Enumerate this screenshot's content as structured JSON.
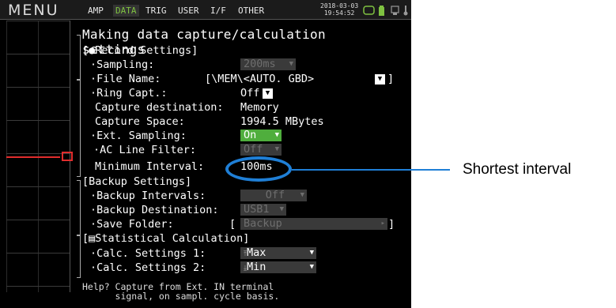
{
  "topbar": {
    "menu": "MENU",
    "tabs": [
      "AMP",
      "DATA",
      "TRIG",
      "USER",
      "I/F",
      "OTHER"
    ],
    "active_tab": "DATA",
    "date": "2018-03-03",
    "time": "19:54:52"
  },
  "panel": {
    "title": "Making data capture/calculation settings",
    "record": {
      "header": "[●Record Settings]",
      "sampling_label": "·Sampling:",
      "sampling_value": "200ms",
      "file_name_label": "·File Name:",
      "file_name_value": "[\\MEM\\<AUTO. GBD>",
      "file_name_close": "]",
      "ring_capt_label": "·Ring Capt.:",
      "ring_capt_value": "Off",
      "capture_dest_label": "Capture destination:",
      "capture_dest_value": "Memory",
      "capture_space_label": "Capture Space:",
      "capture_space_value": "1994.5 MBytes",
      "ext_sampling_label": "·Ext. Sampling:",
      "ext_sampling_value": "On",
      "ac_filter_label": "·AC Line Filter:",
      "ac_filter_value": "Off",
      "min_interval_label": "Minimum Interval:",
      "min_interval_value": "100ms"
    },
    "backup": {
      "header": "[Backup Settings]",
      "intervals_label": "·Backup Intervals:",
      "intervals_value": "Off",
      "destination_label": "·Backup Destination:",
      "destination_value": "USB1",
      "folder_label": "·Save Folder:",
      "folder_open": "[",
      "folder_value": "Backup",
      "folder_close": "]"
    },
    "stats": {
      "header": "[▤Statistical Calculation]",
      "calc1_label": "·Calc. Settings 1:",
      "calc1_value": "Max",
      "calc2_label": "·Calc. Settings 2:",
      "calc2_value": "Min"
    }
  },
  "help": {
    "line1": "Help? Capture from Ext. IN terminal",
    "line2": "      signal, on sampl. cycle basis."
  },
  "callout": {
    "text": "Shortest interval",
    "color": "#1f7fd6"
  },
  "colors": {
    "active_tab": "#7fc241",
    "on_value": "#4fae3d",
    "trace": "#e12d2d"
  }
}
